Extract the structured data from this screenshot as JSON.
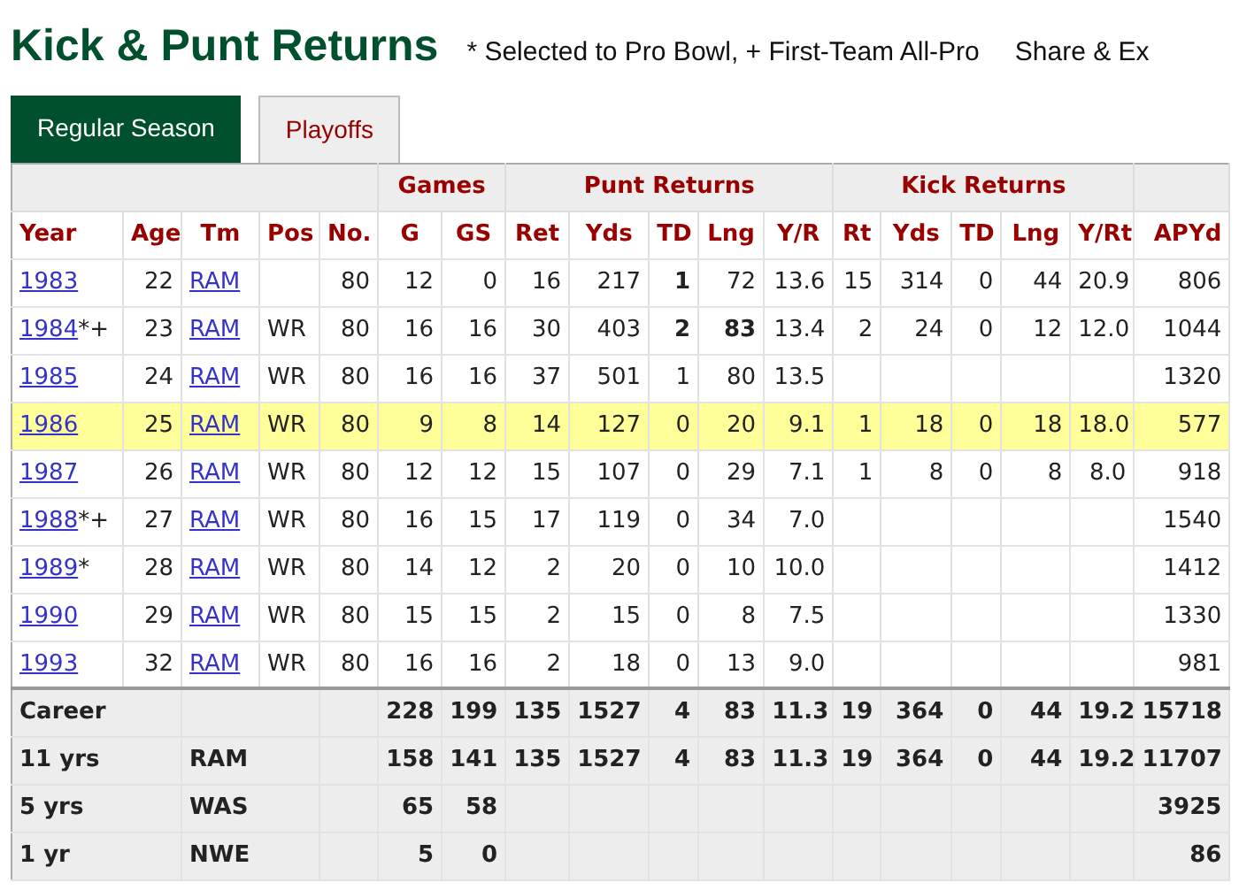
{
  "title": "Kick & Punt Returns",
  "legend": "* Selected to Pro Bowl, + First-Team All-Pro",
  "share": "Share & Ex",
  "tabs": [
    {
      "label": "Regular Season",
      "selected": true
    },
    {
      "label": "Playoffs",
      "selected": false
    }
  ],
  "table": {
    "header_groups": [
      {
        "columns": [
          "Year",
          "Age",
          "Tm",
          "Pos",
          "No."
        ]
      },
      {
        "label": "Games",
        "columns": [
          "G",
          "GS"
        ]
      },
      {
        "label": "Punt Returns",
        "columns": [
          "Ret",
          "Yds",
          "TD",
          "Lng",
          "Y/R"
        ]
      },
      {
        "label": "Kick Returns",
        "columns": [
          "Rt",
          "Yds",
          "TD",
          "Lng",
          "Y/Rt"
        ]
      },
      {
        "columns": [
          "APYd"
        ]
      }
    ],
    "rows": [
      {
        "year": "1983",
        "age": "22",
        "team": "RAM",
        "highlighted": false,
        "stats": {
          "no": "80",
          "g": "12",
          "gs": "0",
          "ret": "16",
          "pyds": "217",
          "ptd": "**1**",
          "plng": "72",
          "ypr": "13.6",
          "rt": "15",
          "kyds": "314",
          "ktd": "0",
          "klng": "44",
          "ykr": "20.9",
          "apyd": "806"
        }
      },
      {
        "year": "1984",
        "mark": "*+",
        "age": "23",
        "team": "RAM",
        "pos": "WR",
        "highlighted": false,
        "stats": {
          "no": "80",
          "g": "16",
          "gs": "16",
          "ret": "30",
          "pyds": "403",
          "ptd": "**2**",
          "plng": "**83**",
          "ypr": "13.4",
          "rt": "2",
          "kyds": "24",
          "ktd": "0",
          "klng": "12",
          "ykr": "12.0",
          "apyd": "1044"
        }
      },
      {
        "year": "1985",
        "age": "24",
        "team": "RAM",
        "pos": "WR",
        "highlighted": false,
        "stats": {
          "no": "80",
          "g": "16",
          "gs": "16",
          "ret": "37",
          "pyds": "501",
          "ptd": "1",
          "plng": "80",
          "ypr": "13.5",
          "apyd": "1320"
        }
      },
      {
        "year": "1986",
        "age": "25",
        "team": "RAM",
        "pos": "WR",
        "highlighted": true,
        "stats": {
          "no": "80",
          "g": "9",
          "gs": "8",
          "ret": "14",
          "pyds": "127",
          "ptd": "0",
          "plng": "20",
          "ypr": "9.1",
          "rt": "1",
          "kyds": "18",
          "ktd": "0",
          "klng": "18",
          "ykr": "18.0",
          "apyd": "577"
        }
      },
      {
        "year": "1987",
        "age": "26",
        "team": "RAM",
        "pos": "WR",
        "highlighted": false,
        "stats": {
          "no": "80",
          "g": "12",
          "gs": "12",
          "ret": "15",
          "pyds": "107",
          "ptd": "0",
          "plng": "29",
          "ypr": "7.1",
          "rt": "1",
          "kyds": "8",
          "ktd": "0",
          "klng": "8",
          "ykr": "8.0",
          "apyd": "918"
        }
      },
      {
        "year": "1988",
        "mark": "*+",
        "age": "27",
        "team": "RAM",
        "pos": "WR",
        "highlighted": false,
        "stats": {
          "no": "80",
          "g": "16",
          "gs": "15",
          "ret": "17",
          "pyds": "119",
          "ptd": "0",
          "plng": "34",
          "ypr": "7.0",
          "apyd": "1540"
        }
      },
      {
        "year": "1989",
        "mark": "*",
        "age": "28",
        "team": "RAM",
        "pos": "WR",
        "highlighted": false,
        "stats": {
          "no": "80",
          "g": "14",
          "gs": "12",
          "ret": "2",
          "pyds": "20",
          "ptd": "0",
          "plng": "10",
          "ypr": "10.0",
          "apyd": "1412"
        }
      },
      {
        "year": "1990",
        "age": "29",
        "team": "RAM",
        "pos": "WR",
        "highlighted": false,
        "stats": {
          "no": "80",
          "g": "15",
          "gs": "15",
          "ret": "2",
          "pyds": "15",
          "ptd": "0",
          "plng": "8",
          "ypr": "7.5",
          "apyd": "1330"
        }
      },
      {
        "year": "1993",
        "age": "32",
        "team": "RAM",
        "pos": "WR",
        "highlighted": false,
        "stats": {
          "no": "80",
          "g": "16",
          "gs": "16",
          "ret": "2",
          "pyds": "18",
          "ptd": "0",
          "plng": "13",
          "ypr": "9.0",
          "apyd": "981"
        }
      }
    ],
    "footer": [
      {
        "label": "Career",
        "stats": {
          "g": "228",
          "gs": "199",
          "ret": "135",
          "pyds": "1527",
          "ptd": "4",
          "plng": "83",
          "ypr": "11.3",
          "rt": "19",
          "kyds": "364",
          "ktd": "0",
          "klng": "44",
          "ykr": "19.2",
          "apyd": "15718"
        }
      },
      {
        "label": "11 yrs",
        "team": "RAM",
        "stats": {
          "g": "158",
          "gs": "141",
          "ret": "135",
          "pyds": "1527",
          "ptd": "4",
          "plng": "83",
          "ypr": "11.3",
          "rt": "19",
          "kyds": "364",
          "ktd": "0",
          "klng": "44",
          "ykr": "19.2",
          "apyd": "11707"
        }
      },
      {
        "label": "5 yrs",
        "team": "WAS",
        "stats": {
          "g": "65",
          "gs": "58",
          "apyd": "3925"
        }
      },
      {
        "label": "1 yr",
        "team": "NWE",
        "stats": {
          "g": "5",
          "gs": "0",
          "apyd": "86"
        }
      }
    ]
  }
}
